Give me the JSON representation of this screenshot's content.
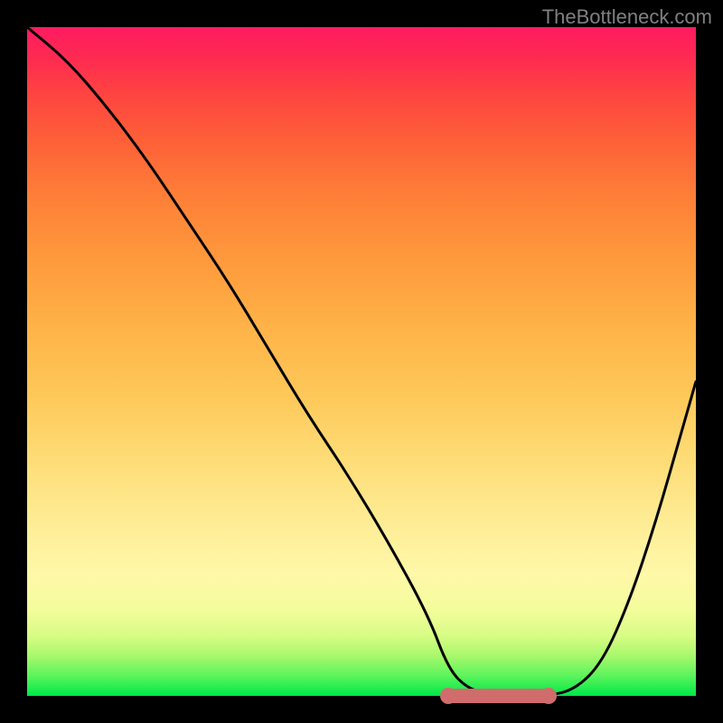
{
  "watermark": "TheBottleneck.com",
  "chart_data": {
    "type": "line",
    "title": "",
    "xlabel": "",
    "ylabel": "",
    "xlim": [
      0,
      100
    ],
    "ylim": [
      0,
      100
    ],
    "series": [
      {
        "name": "bottleneck-curve",
        "x": [
          0,
          6,
          12,
          18,
          24,
          30,
          36,
          42,
          48,
          54,
          60,
          63,
          66,
          70,
          74,
          78,
          82,
          86,
          90,
          94,
          98,
          100
        ],
        "y": [
          100,
          95,
          88,
          80,
          71,
          62,
          52,
          42,
          33,
          23,
          12,
          4,
          1,
          0,
          0,
          0,
          1,
          5,
          14,
          26,
          40,
          47
        ]
      }
    ],
    "highlight": {
      "name": "optimal-range",
      "x_start": 63,
      "x_end": 78,
      "y": 0
    },
    "background_gradient": {
      "top": "#fe1a60",
      "mid": "#fedd78",
      "bottom": "#00e848"
    }
  }
}
